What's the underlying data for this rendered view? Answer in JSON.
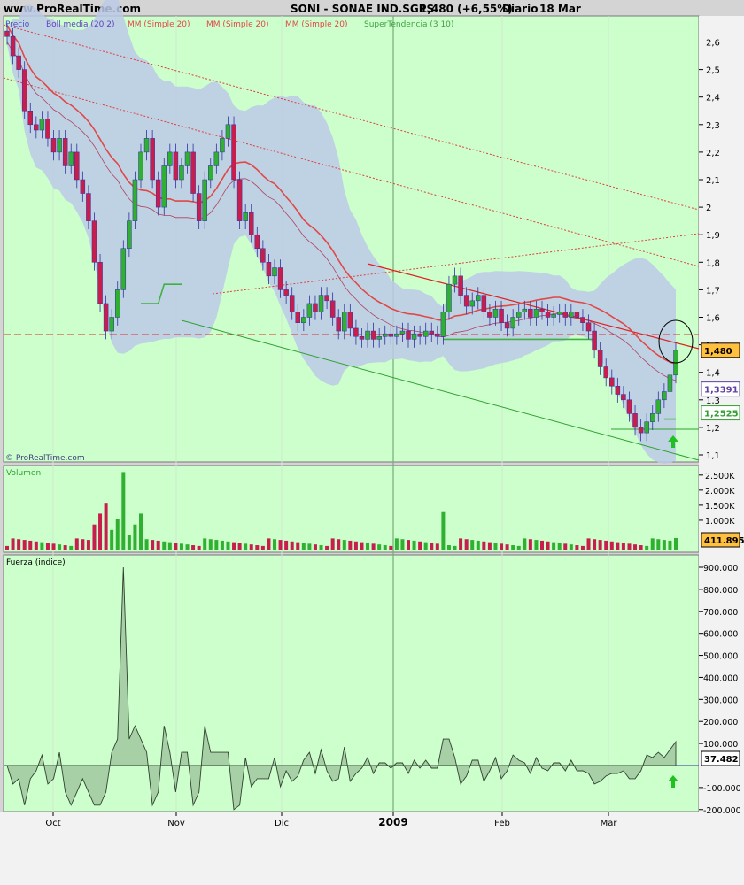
{
  "header": {
    "site": "www.ProRealTime.com",
    "instrument": "SONI - SONAE IND.SGPS",
    "quote": "1,480 (+6,55%)",
    "period": "Diario",
    "date": "18 Mar"
  },
  "legend": [
    {
      "label": "Precio",
      "color": "#5050c0"
    },
    {
      "label": "Boll media (20 2)",
      "color": "#6040c0"
    },
    {
      "label": "MM (Simple 20)",
      "color": "#e04848"
    },
    {
      "label": "MM (Simple 20)",
      "color": "#e04848"
    },
    {
      "label": "MM (Simple 20)",
      "color": "#e04848"
    },
    {
      "label": "SuperTendencia (3 10)",
      "color": "#40a040"
    }
  ],
  "copyright": "© ProRealTime.com",
  "colors": {
    "background": "#ccffcc",
    "up": "#30b030",
    "down": "#c81e4e",
    "band": "#bccae6",
    "ma": "#e04848",
    "supertrend": "#40b040",
    "boll": "#b04060"
  },
  "chart_data": [
    {
      "type": "candlestick",
      "title": "Precio",
      "x_ticks": [
        "Oct",
        "Nov",
        "Dic",
        "2009",
        "Feb",
        "Mar"
      ],
      "y_ticks": [
        "2,6",
        "2,5",
        "2,4",
        "2,3",
        "2,2",
        "2,1",
        "2",
        "1,9",
        "1,8",
        "1,7",
        "1,6",
        "1,5",
        "1,4",
        "1,3",
        "1,2",
        "1,1"
      ],
      "ylim": [
        1.1,
        2.65
      ],
      "close_series": [
        2.62,
        2.55,
        2.5,
        2.35,
        2.3,
        2.28,
        2.32,
        2.25,
        2.2,
        2.25,
        2.15,
        2.2,
        2.1,
        2.05,
        1.95,
        1.8,
        1.65,
        1.55,
        1.6,
        1.7,
        1.85,
        1.95,
        2.1,
        2.2,
        2.25,
        2.1,
        2.0,
        2.15,
        2.2,
        2.1,
        2.15,
        2.2,
        2.05,
        1.95,
        2.1,
        2.15,
        2.2,
        2.25,
        2.3,
        2.1,
        1.95,
        1.98,
        1.9,
        1.85,
        1.8,
        1.75,
        1.78,
        1.7,
        1.68,
        1.62,
        1.58,
        1.6,
        1.65,
        1.62,
        1.68,
        1.66,
        1.6,
        1.55,
        1.62,
        1.56,
        1.53,
        1.52,
        1.55,
        1.52,
        1.53,
        1.54,
        1.53,
        1.54,
        1.55,
        1.52,
        1.54,
        1.53,
        1.55,
        1.54,
        1.53,
        1.62,
        1.72,
        1.75,
        1.68,
        1.64,
        1.66,
        1.68,
        1.62,
        1.6,
        1.63,
        1.58,
        1.56,
        1.6,
        1.62,
        1.63,
        1.6,
        1.63,
        1.62,
        1.6,
        1.61,
        1.62,
        1.6,
        1.62,
        1.6,
        1.58,
        1.55,
        1.48,
        1.42,
        1.38,
        1.35,
        1.32,
        1.3,
        1.25,
        1.2,
        1.18,
        1.22,
        1.25,
        1.3,
        1.33,
        1.39,
        1.48
      ],
      "labels": [
        {
          "text": "1,480",
          "value": 1.48
        },
        {
          "text": "1,3391",
          "value": 1.3391
        },
        {
          "text": "1,2525",
          "value": 1.2525
        }
      ],
      "overlays": [
        "Bollinger bands (20 2)",
        "MM Simple 20",
        "SuperTendencia (3 10)",
        "trend lines"
      ],
      "grid": false
    },
    {
      "type": "bar",
      "title": "Volumen",
      "y_ticks": [
        "2.500K",
        "2.000K",
        "1.500K",
        "1.000K"
      ],
      "ylim": [
        0,
        2700000
      ],
      "last_value": "411.895",
      "peaks": [
        {
          "position": "mid-Oct",
          "value": 2600000
        }
      ]
    },
    {
      "type": "line",
      "title": "Fuerza (indice)",
      "y_ticks": [
        "900.000",
        "800.000",
        "700.000",
        "600.000",
        "500.000",
        "400.000",
        "300.000",
        "200.000",
        "100.000",
        "-100.000",
        "-200.000"
      ],
      "ylim": [
        -230000,
        960000
      ],
      "last_value": "37.482",
      "peaks": [
        {
          "position": "mid-Oct",
          "value": 900000
        }
      ]
    }
  ]
}
